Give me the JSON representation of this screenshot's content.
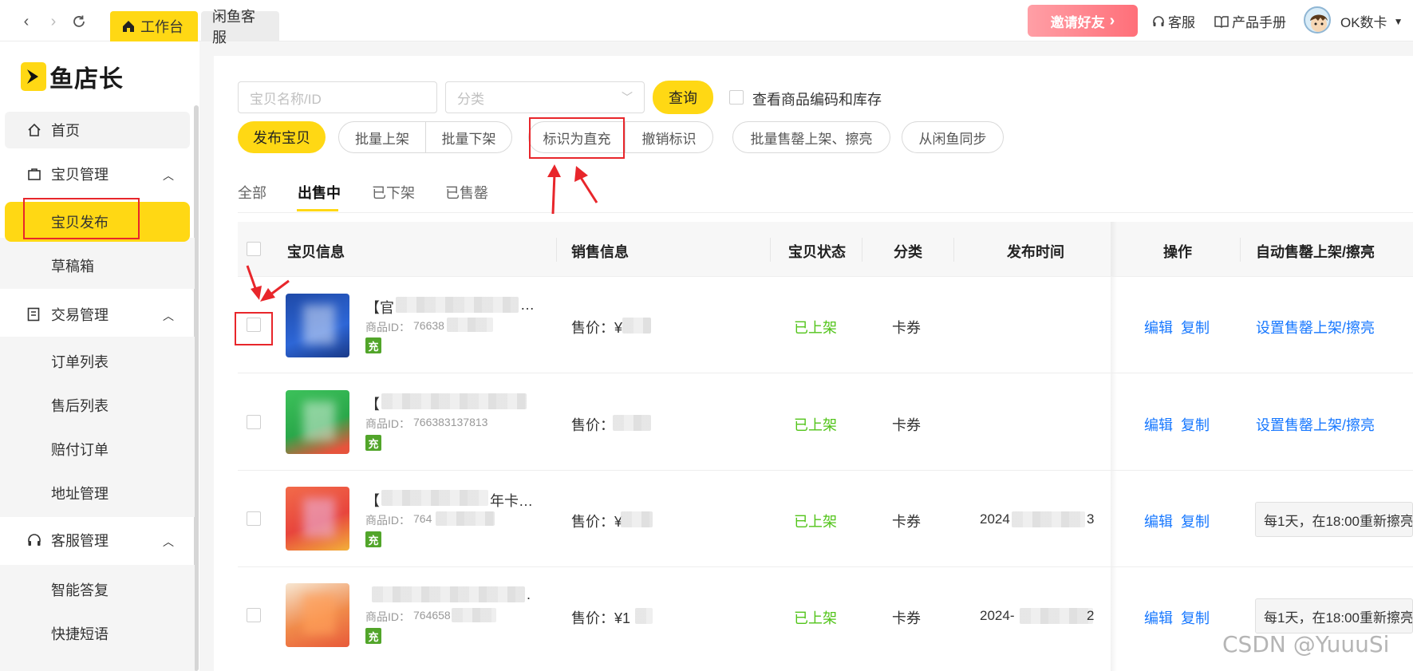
{
  "topbar": {
    "tabs": [
      {
        "label": "工作台",
        "icon": "home-icon"
      },
      {
        "label": "闲鱼客服"
      }
    ],
    "invite_label": "邀请好友",
    "service_label": "客服",
    "manual_label": "产品手册",
    "user_name": "OK数卡"
  },
  "sidebar": {
    "logo_text": "鱼店长",
    "home": {
      "label": "首页",
      "icon": "home-icon"
    },
    "groups": [
      {
        "label": "宝贝管理",
        "icon": "bag-icon",
        "items": [
          "宝贝发布",
          "草稿箱"
        ]
      },
      {
        "label": "交易管理",
        "icon": "document-icon",
        "items": [
          "订单列表",
          "售后列表",
          "赔付订单",
          "地址管理"
        ]
      },
      {
        "label": "客服管理",
        "icon": "headset-icon",
        "items": [
          "智能答复",
          "快捷短语"
        ]
      }
    ],
    "active_item": "宝贝发布"
  },
  "filters": {
    "name_placeholder": "宝贝名称/ID",
    "category_placeholder": "分类",
    "query_label": "查询",
    "show_code_label": "查看商品编码和库存"
  },
  "toolbar": {
    "publish_label": "发布宝贝",
    "batch_on_label": "批量上架",
    "batch_off_label": "批量下架",
    "mark_direct_label": "标识为直充",
    "cancel_mark_label": "撤销标识",
    "batch_soldout_label": "批量售罄上架、擦亮",
    "sync_label": "从闲鱼同步"
  },
  "status_tabs": [
    "全部",
    "出售中",
    "已下架",
    "已售罄"
  ],
  "active_status_tab": "出售中",
  "table": {
    "headers": [
      "宝贝信息",
      "销售信息",
      "宝贝状态",
      "分类",
      "发布时间",
      "操作",
      "自动售罄上架/擦亮"
    ],
    "rows": [
      {
        "name": "【官",
        "name_tail": "…",
        "id_label": "商品ID：",
        "id": "76638",
        "price_label": "售价：¥",
        "status": "已上架",
        "category": "卡券",
        "publish_time": "",
        "edit": "编辑",
        "copy": "复制",
        "auto_link": "设置售罄上架/擦亮",
        "badge": "充",
        "thumb_color": "#1f4aa8"
      },
      {
        "name": "【",
        "name_tail": "",
        "id_label": "商品ID：",
        "id": "766383137813",
        "price_label": "售价：",
        "status": "已上架",
        "category": "卡券",
        "publish_time": "",
        "edit": "编辑",
        "copy": "复制",
        "auto_link": "设置售罄上架/擦亮",
        "badge": "充",
        "thumb_color": "#2aa84a"
      },
      {
        "name": "【",
        "name_tail": "年卡…",
        "id_label": "商品ID：",
        "id": "764",
        "price_label": "售价：¥",
        "status": "已上架",
        "category": "卡券",
        "publish_time": "2024",
        "publish_time_tail": "3",
        "edit": "编辑",
        "copy": "复制",
        "auto_text": "每1天，在18:00重新擦亮",
        "badge": "充",
        "thumb_color": "#e8453c"
      },
      {
        "name": "",
        "name_tail": ".",
        "id_label": "商品ID：",
        "id": "764658",
        "price_label": "售价：¥1",
        "status": "已上架",
        "category": "卡券",
        "publish_time": "2024-",
        "publish_time_tail": "2",
        "edit": "编辑",
        "copy": "复制",
        "auto_text": "每1天，在18:00重新擦亮",
        "badge": "充",
        "thumb_color": "#e85a3a"
      }
    ]
  },
  "watermark": "CSDN @YuuuSi",
  "colors": {
    "accent": "#ffd814",
    "link": "#1677ff",
    "status_green": "#52c41a",
    "annotation_red": "#e8262b"
  }
}
